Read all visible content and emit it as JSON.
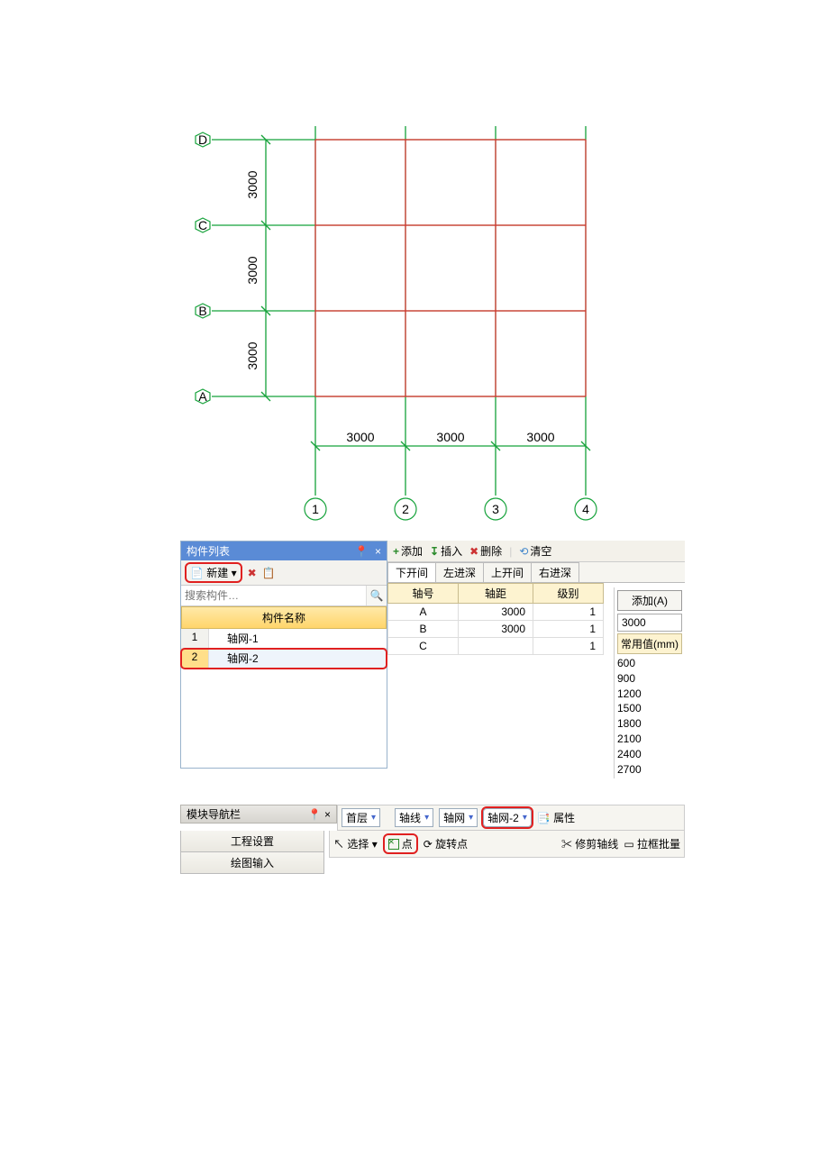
{
  "diagram": {
    "row_labels": [
      "A",
      "B",
      "C",
      "D"
    ],
    "col_labels": [
      "1",
      "2",
      "3",
      "4"
    ],
    "row_dims": [
      "3000",
      "3000",
      "3000"
    ],
    "col_dims": [
      "3000",
      "3000",
      "3000"
    ]
  },
  "panel": {
    "title": "构件列表",
    "pin_icon": "📌",
    "close_icon": "×",
    "new_button": "新建",
    "search_placeholder": "搜索构件…",
    "list_header": "构件名称",
    "rows": [
      {
        "idx": "1",
        "name": "轴网-1"
      },
      {
        "idx": "2",
        "name": "轴网-2"
      }
    ]
  },
  "right": {
    "toolbar": {
      "add": "添加",
      "insert": "插入",
      "delete": "删除",
      "clear": "清空"
    },
    "tabs": [
      "下开间",
      "左进深",
      "上开间",
      "右进深"
    ],
    "columns": [
      "轴号",
      "轴距",
      "级别"
    ],
    "data": [
      {
        "no": "A",
        "dist": "3000",
        "lvl": "1"
      },
      {
        "no": "B",
        "dist": "3000",
        "lvl": "1"
      },
      {
        "no": "C",
        "dist": "",
        "lvl": "1"
      }
    ],
    "side": {
      "add_btn": "添加(A)",
      "value": "3000",
      "header": "常用值(mm)",
      "options": [
        "600",
        "900",
        "1200",
        "1500",
        "1800",
        "2100",
        "2400",
        "2700"
      ]
    }
  },
  "bottom": {
    "nav_title": "模块导航栏",
    "nav_items": [
      "工程设置",
      "绘图输入"
    ],
    "floor": "首层",
    "combo1": "轴线",
    "combo2": "轴网",
    "combo3": "轴网-2",
    "props": "属性",
    "select": "选择",
    "point": "点",
    "rotate": "旋转点",
    "trim": "修剪轴线",
    "box": "拉框批量"
  }
}
